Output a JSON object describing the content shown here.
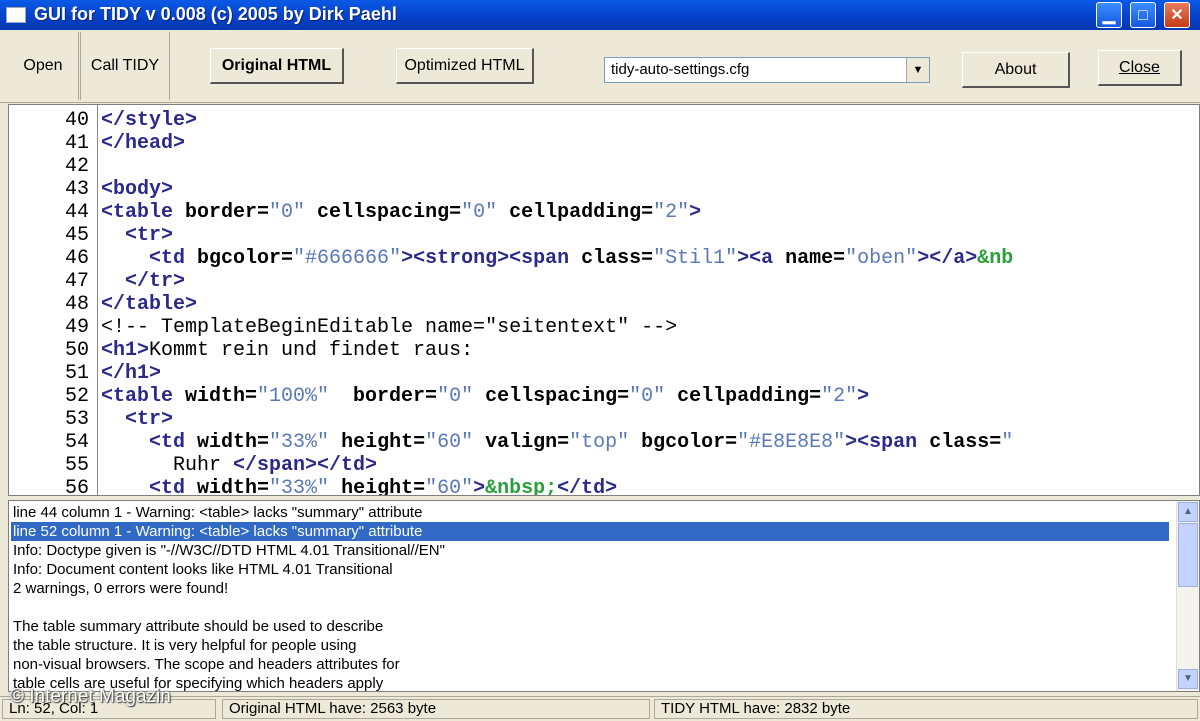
{
  "window": {
    "title": "GUI for TIDY v 0.008 (c) 2005 by Dirk Paehl",
    "minimize": "▁",
    "maximize": "□",
    "close": "✕"
  },
  "toolbar": {
    "open": "Open",
    "call_tidy": "Call TIDY",
    "original_html": "Original HTML",
    "optimized_html": "Optimized HTML",
    "config_select": "tidy-auto-settings.cfg",
    "about": "About",
    "close": "Close"
  },
  "editor": {
    "lines": [
      {
        "n": "40",
        "segs": [
          [
            "t",
            "</style>"
          ]
        ]
      },
      {
        "n": "41",
        "segs": [
          [
            "t",
            "</head>"
          ]
        ]
      },
      {
        "n": "42",
        "segs": []
      },
      {
        "n": "43",
        "segs": [
          [
            "t",
            "<body>"
          ]
        ]
      },
      {
        "n": "44",
        "segs": [
          [
            "t",
            "<table "
          ],
          [
            "a",
            "border="
          ],
          [
            "v",
            "\"0\" "
          ],
          [
            "a",
            "cellspacing="
          ],
          [
            "v",
            "\"0\" "
          ],
          [
            "a",
            "cellpadding="
          ],
          [
            "v",
            "\"2\""
          ],
          [
            "t",
            ">"
          ]
        ]
      },
      {
        "n": "45",
        "segs": [
          [
            "c",
            "  "
          ],
          [
            "t",
            "<tr>"
          ]
        ]
      },
      {
        "n": "46",
        "segs": [
          [
            "c",
            "    "
          ],
          [
            "t",
            "<td "
          ],
          [
            "a",
            "bgcolor="
          ],
          [
            "v",
            "\"#666666\""
          ],
          [
            "t",
            "><strong><span "
          ],
          [
            "a",
            "class="
          ],
          [
            "v",
            "\"Stil1\""
          ],
          [
            "t",
            "><a "
          ],
          [
            "a",
            "name="
          ],
          [
            "v",
            "\"oben\""
          ],
          [
            "t",
            "></a>"
          ],
          [
            "e",
            "&nb"
          ]
        ]
      },
      {
        "n": "47",
        "segs": [
          [
            "c",
            "  "
          ],
          [
            "t",
            "</tr>"
          ]
        ]
      },
      {
        "n": "48",
        "segs": [
          [
            "t",
            "</table>"
          ]
        ]
      },
      {
        "n": "49",
        "segs": [
          [
            "c",
            "<!-- TemplateBeginEditable name=\"seitentext\" -->"
          ]
        ]
      },
      {
        "n": "50",
        "segs": [
          [
            "t",
            "<h1>"
          ],
          [
            "c",
            "Kommt rein und findet raus:"
          ]
        ]
      },
      {
        "n": "51",
        "segs": [
          [
            "t",
            "</h1>"
          ]
        ]
      },
      {
        "n": "52",
        "segs": [
          [
            "t",
            "<table "
          ],
          [
            "a",
            "width="
          ],
          [
            "v",
            "\"100%\"  "
          ],
          [
            "a",
            "border="
          ],
          [
            "v",
            "\"0\" "
          ],
          [
            "a",
            "cellspacing="
          ],
          [
            "v",
            "\"0\" "
          ],
          [
            "a",
            "cellpadding="
          ],
          [
            "v",
            "\"2\""
          ],
          [
            "t",
            ">"
          ]
        ]
      },
      {
        "n": "53",
        "segs": [
          [
            "c",
            "  "
          ],
          [
            "t",
            "<tr>"
          ]
        ]
      },
      {
        "n": "54",
        "segs": [
          [
            "c",
            "    "
          ],
          [
            "t",
            "<td "
          ],
          [
            "a",
            "width="
          ],
          [
            "v",
            "\"33%\" "
          ],
          [
            "a",
            "height="
          ],
          [
            "v",
            "\"60\" "
          ],
          [
            "a",
            "valign="
          ],
          [
            "v",
            "\"top\" "
          ],
          [
            "a",
            "bgcolor="
          ],
          [
            "v",
            "\"#E8E8E8\""
          ],
          [
            "t",
            "><span "
          ],
          [
            "a",
            "class="
          ],
          [
            "v",
            "\""
          ]
        ]
      },
      {
        "n": "55",
        "segs": [
          [
            "c",
            "      Ruhr "
          ],
          [
            "t",
            "</span></td>"
          ]
        ]
      },
      {
        "n": "56",
        "segs": [
          [
            "c",
            "    "
          ],
          [
            "t",
            "<td "
          ],
          [
            "a",
            "width="
          ],
          [
            "v",
            "\"33%\" "
          ],
          [
            "a",
            "height="
          ],
          [
            "v",
            "\"60\""
          ],
          [
            "t",
            ">"
          ],
          [
            "e",
            "&nbsp;"
          ],
          [
            "t",
            "</td>"
          ]
        ]
      }
    ]
  },
  "messages": [
    "line 44 column 1 - Warning: <table> lacks \"summary\" attribute",
    "line 52 column 1 - Warning: <table> lacks \"summary\" attribute",
    "Info: Doctype given is \"-//W3C//DTD HTML 4.01 Transitional//EN\"",
    "Info: Document content looks like HTML 4.01 Transitional",
    "2 warnings, 0 errors were found!",
    "",
    "The table summary attribute should be used to describe",
    "the table structure. It is very helpful for people using",
    "non-visual browsers. The scope and headers attributes for",
    "table cells are useful for specifying which headers apply"
  ],
  "selected_message": 1,
  "status": {
    "cursor": "Ln:    52, Col:  1",
    "original_size": "Original HTML have: 2563 byte",
    "tidy_size": "TIDY HTML have: 2832 byte"
  },
  "watermark": "© Internet Magazin",
  "icons": {
    "scroll_up": "up-arrow-icon",
    "scroll_down": "down-arrow-icon",
    "combo": "chevron-down-icon"
  }
}
